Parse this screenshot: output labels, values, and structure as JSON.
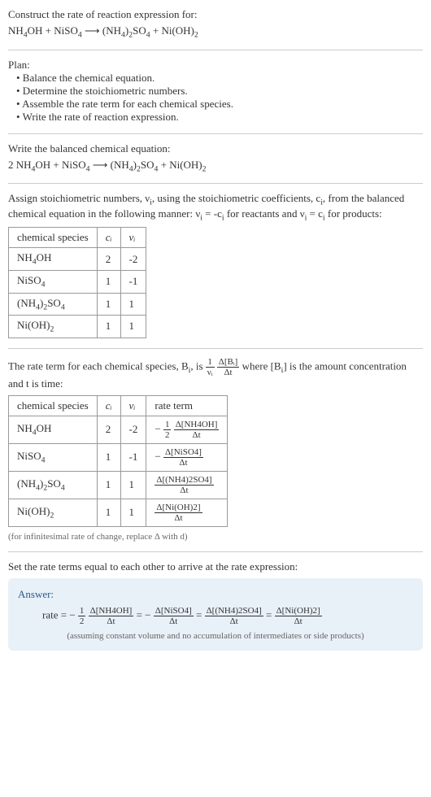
{
  "prompt": {
    "line1": "Construct the rate of reaction expression for:",
    "eq_lhs1": "NH",
    "eq_lhs1_sub": "4",
    "eq_lhs2": "OH + NiSO",
    "eq_lhs2_sub": "4",
    "arrow": " ⟶ ",
    "eq_rhs1": "(NH",
    "eq_rhs1_sub": "4",
    "eq_rhs2": ")",
    "eq_rhs2_sub": "2",
    "eq_rhs3": "SO",
    "eq_rhs3_sub": "4",
    "eq_rhs4": " + Ni(OH)",
    "eq_rhs4_sub": "2"
  },
  "plan": {
    "title": "Plan:",
    "item1": "• Balance the chemical equation.",
    "item2": "• Determine the stoichiometric numbers.",
    "item3": "• Assemble the rate term for each chemical species.",
    "item4": "• Write the rate of reaction expression."
  },
  "balanced": {
    "title": "Write the balanced chemical equation:",
    "coef": "2 NH",
    "sub1": "4",
    "part2": "OH + NiSO",
    "sub2": "4",
    "arrow": " ⟶ ",
    "part3": "(NH",
    "sub3": "4",
    "part4": ")",
    "sub4": "2",
    "part5": "SO",
    "sub5": "4",
    "part6": " + Ni(OH)",
    "sub6": "2"
  },
  "assign": {
    "text1": "Assign stoichiometric numbers, ν",
    "sub_i1": "i",
    "text2": ", using the stoichiometric coefficients, c",
    "sub_i2": "i",
    "text3": ", from the balanced chemical equation in the following manner: ν",
    "sub_i3": "i",
    "text4": " = -c",
    "sub_i4": "i",
    "text5": " for reactants and ν",
    "sub_i5": "i",
    "text6": " = c",
    "sub_i6": "i",
    "text7": " for products:"
  },
  "table1": {
    "h1": "chemical species",
    "h2": "cᵢ",
    "h3": "νᵢ",
    "r1c1a": "NH",
    "r1c1a_sub": "4",
    "r1c1b": "OH",
    "r1c2": "2",
    "r1c3": "-2",
    "r2c1a": "NiSO",
    "r2c1a_sub": "4",
    "r2c2": "1",
    "r2c3": "-1",
    "r3c1a": "(NH",
    "r3c1a_sub": "4",
    "r3c1b": ")",
    "r3c1b_sub": "2",
    "r3c1c": "SO",
    "r3c1c_sub": "4",
    "r3c2": "1",
    "r3c3": "1",
    "r4c1a": "Ni(OH)",
    "r4c1a_sub": "2",
    "r4c2": "1",
    "r4c3": "1"
  },
  "rateterm": {
    "text1": "The rate term for each chemical species, B",
    "sub1": "i",
    "text2": ", is ",
    "frac1_num": "1",
    "frac1_den": "νᵢ",
    "frac2_num": "Δ[Bᵢ]",
    "frac2_den": "Δt",
    "text3": " where [B",
    "sub2": "i",
    "text4": "] is the amount concentration and t is time:"
  },
  "table2": {
    "h1": "chemical species",
    "h2": "cᵢ",
    "h3": "νᵢ",
    "h4": "rate term",
    "r1c1a": "NH",
    "r1c1a_sub": "4",
    "r1c1b": "OH",
    "r1c2": "2",
    "r1c3": "-2",
    "r1c4_prefix": "−",
    "r1c4_f1n": "1",
    "r1c4_f1d": "2",
    "r1c4_f2n": "Δ[NH4OH]",
    "r1c4_f2d": "Δt",
    "r2c1a": "NiSO",
    "r2c1a_sub": "4",
    "r2c2": "1",
    "r2c3": "-1",
    "r2c4_prefix": "−",
    "r2c4_f2n": "Δ[NiSO4]",
    "r2c4_f2d": "Δt",
    "r3c1a": "(NH",
    "r3c1a_sub": "4",
    "r3c1b": ")",
    "r3c1b_sub": "2",
    "r3c1c": "SO",
    "r3c1c_sub": "4",
    "r3c2": "1",
    "r3c3": "1",
    "r3c4_f2n": "Δ[(NH4)2SO4]",
    "r3c4_f2d": "Δt",
    "r4c1a": "Ni(OH)",
    "r4c1a_sub": "2",
    "r4c2": "1",
    "r4c3": "1",
    "r4c4_f2n": "Δ[Ni(OH)2]",
    "r4c4_f2d": "Δt"
  },
  "note1": "(for infinitesimal rate of change, replace Δ with d)",
  "final_text": "Set the rate terms equal to each other to arrive at the rate expression:",
  "answer": {
    "title": "Answer:",
    "rate_label": "rate = −",
    "f1n": "1",
    "f1d": "2",
    "f2n": "Δ[NH4OH]",
    "f2d": "Δt",
    "eq1": " = −",
    "f3n": "Δ[NiSO4]",
    "f3d": "Δt",
    "eq2": " = ",
    "f4n": "Δ[(NH4)2SO4]",
    "f4d": "Δt",
    "eq3": " = ",
    "f5n": "Δ[Ni(OH)2]",
    "f5d": "Δt",
    "note": "(assuming constant volume and no accumulation of intermediates or side products)"
  }
}
